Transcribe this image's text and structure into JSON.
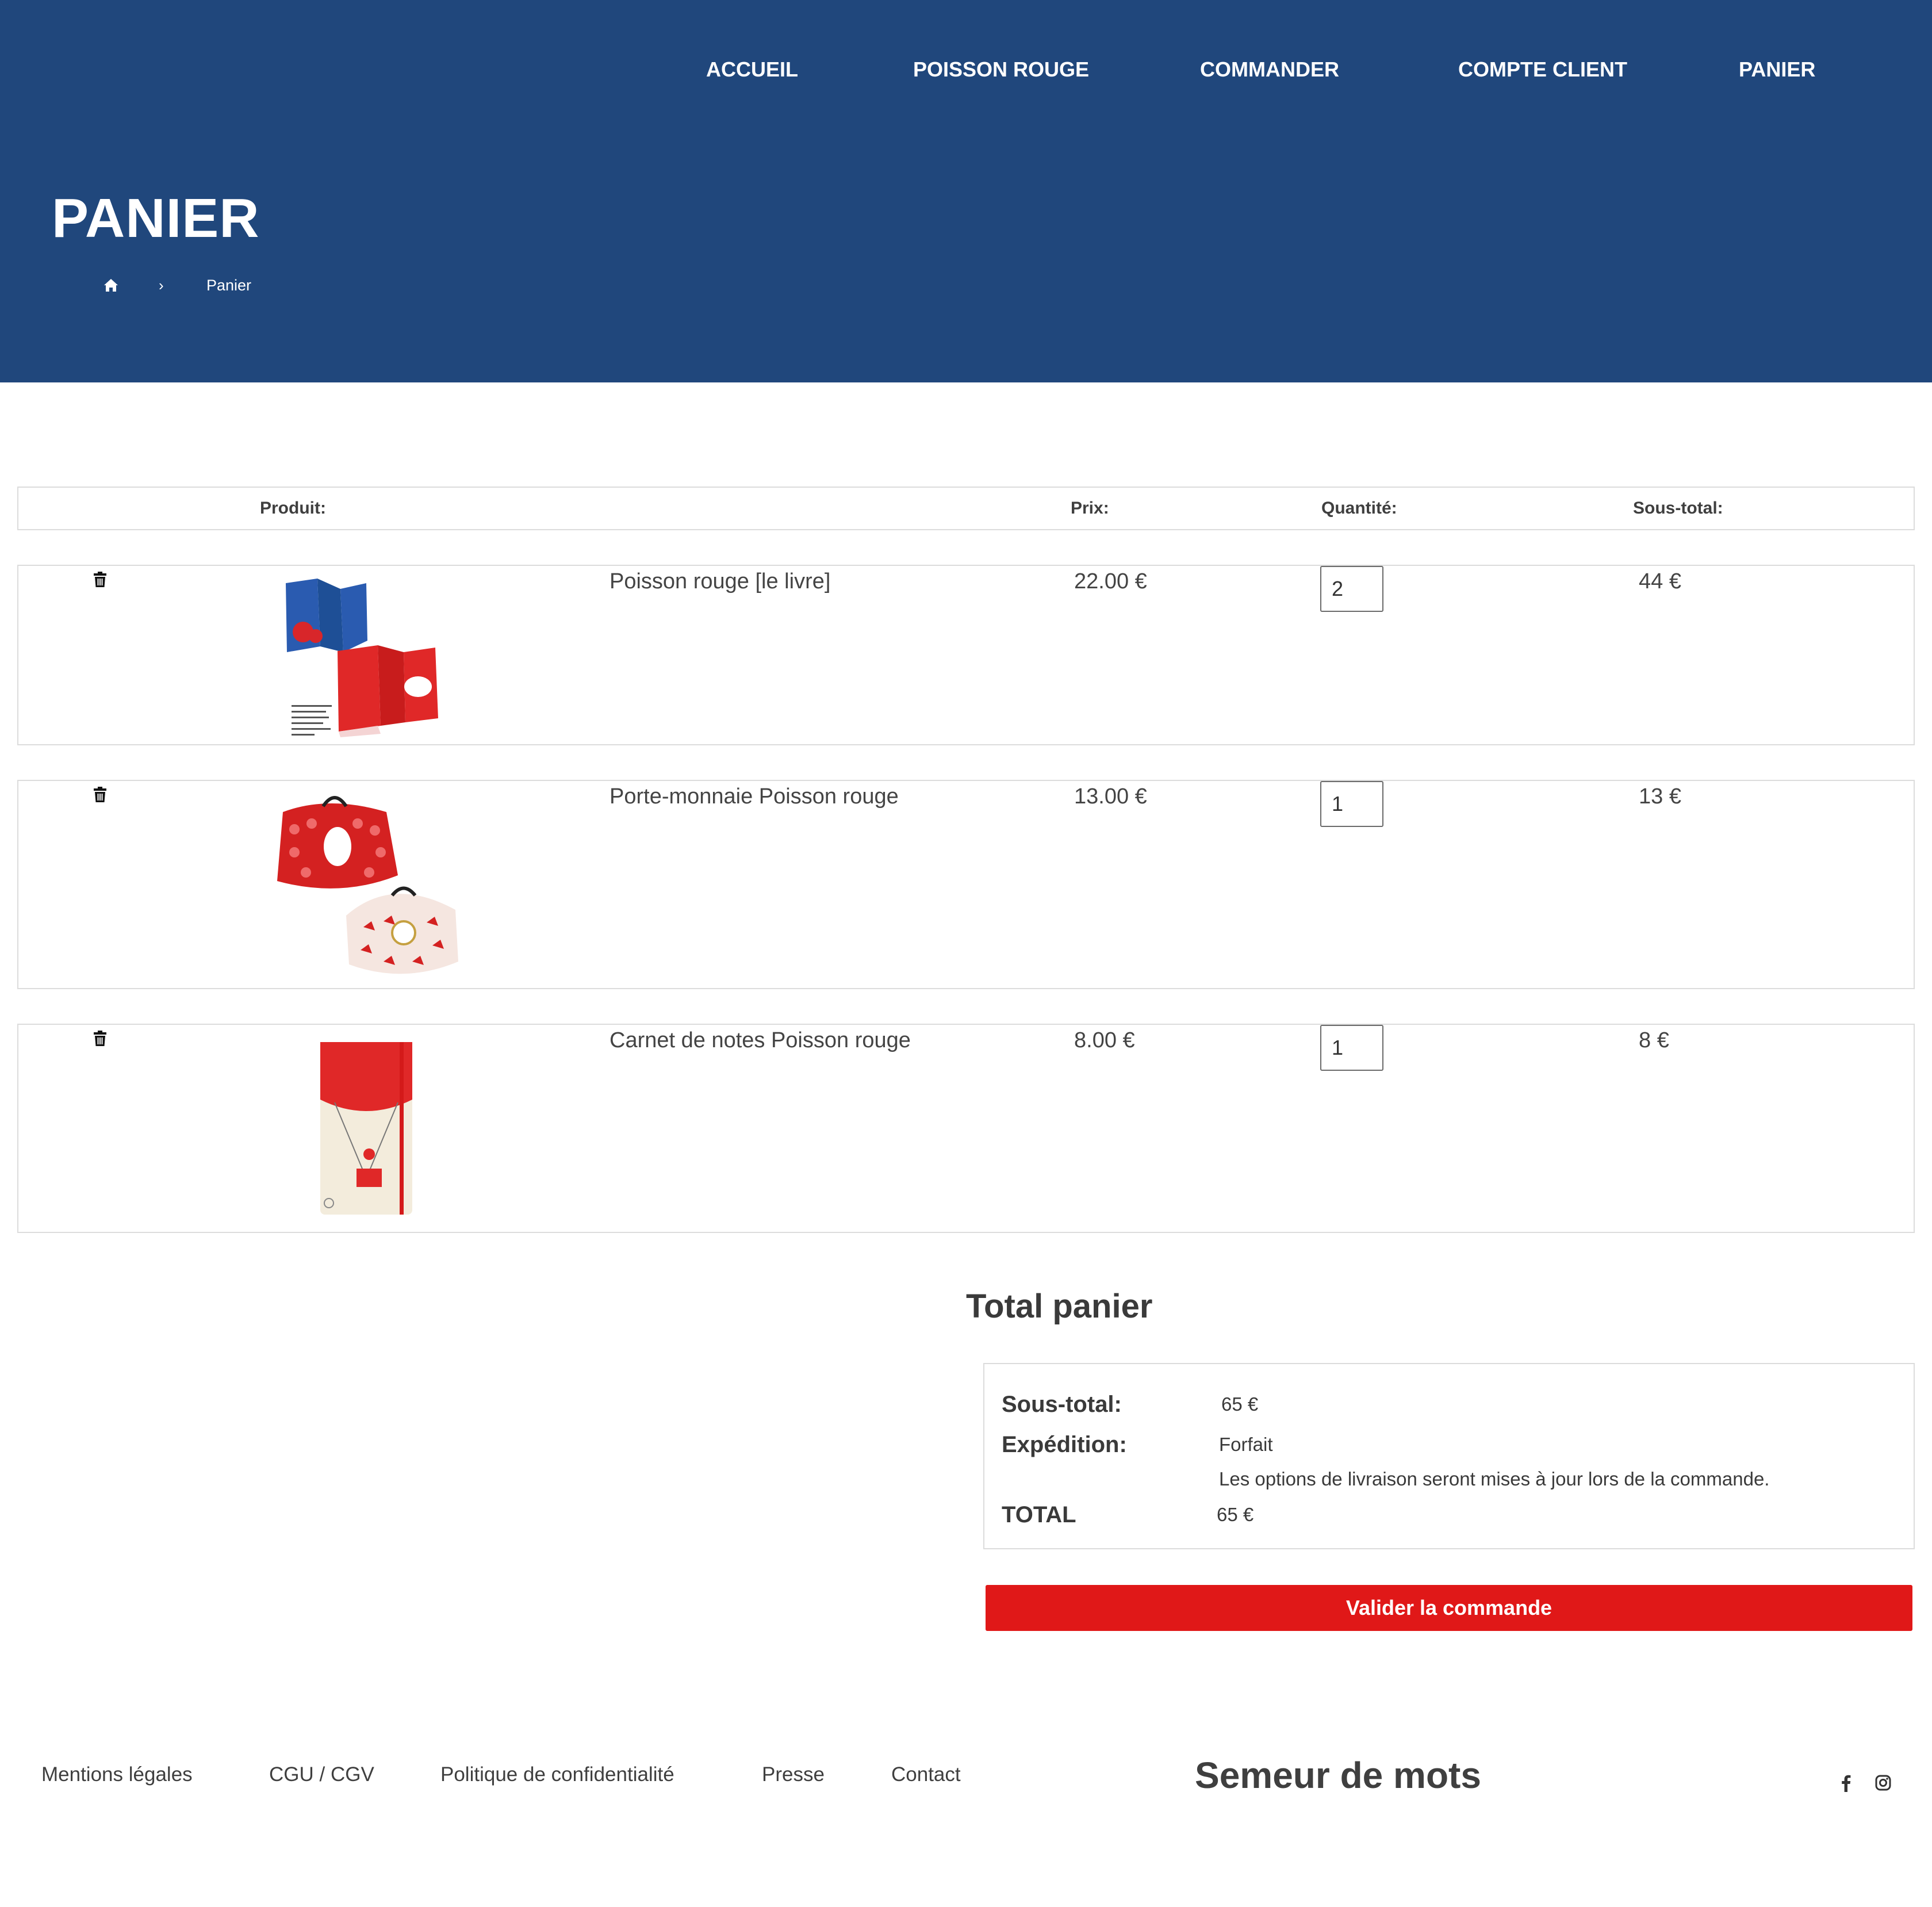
{
  "colors": {
    "header_bg": "#20477c",
    "accent_button": "#e01818",
    "text": "#3a3a3a",
    "border": "#dcdcdc"
  },
  "nav": {
    "items": [
      {
        "label": "ACCUEIL"
      },
      {
        "label": "POISSON ROUGE"
      },
      {
        "label": "COMMANDER"
      },
      {
        "label": "COMPTE CLIENT"
      },
      {
        "label": "PANIER"
      }
    ]
  },
  "page": {
    "title": "PANIER",
    "breadcrumb": {
      "home_icon": "home-icon",
      "separator": "›",
      "current": "Panier"
    }
  },
  "cart": {
    "headers": {
      "product": "Produit:",
      "price": "Prix:",
      "quantity": "Quantité:",
      "subtotal": "Sous-total:"
    },
    "items": [
      {
        "name": "Poisson rouge [le livre]",
        "price": "22.00 €",
        "quantity": "2",
        "subtotal": "44 €",
        "remove_icon": "trash-icon"
      },
      {
        "name": "Porte-monnaie Poisson rouge",
        "price": "13.00 €",
        "quantity": "1",
        "subtotal": "13 €",
        "remove_icon": "trash-icon"
      },
      {
        "name": "Carnet de notes Poisson rouge",
        "price": "8.00 €",
        "quantity": "1",
        "subtotal": "8 €",
        "remove_icon": "trash-icon"
      }
    ]
  },
  "totals": {
    "heading": "Total panier",
    "subtotal_label": "Sous-total:",
    "subtotal_value": "65 €",
    "shipping_label": "Expédition:",
    "shipping_value": "Forfait",
    "shipping_note": "Les options de livraison seront mises à jour lors de la commande.",
    "total_label": "TOTAL",
    "total_value": "65 €",
    "checkout_label": "Valider la commande"
  },
  "footer": {
    "links": [
      {
        "label": "Mentions légales"
      },
      {
        "label": "CGU / CGV"
      },
      {
        "label": "Politique de confidentialité"
      },
      {
        "label": "Presse"
      },
      {
        "label": "Contact"
      }
    ],
    "brand": "Semeur de mots",
    "social": [
      "facebook-icon",
      "instagram-icon"
    ]
  }
}
